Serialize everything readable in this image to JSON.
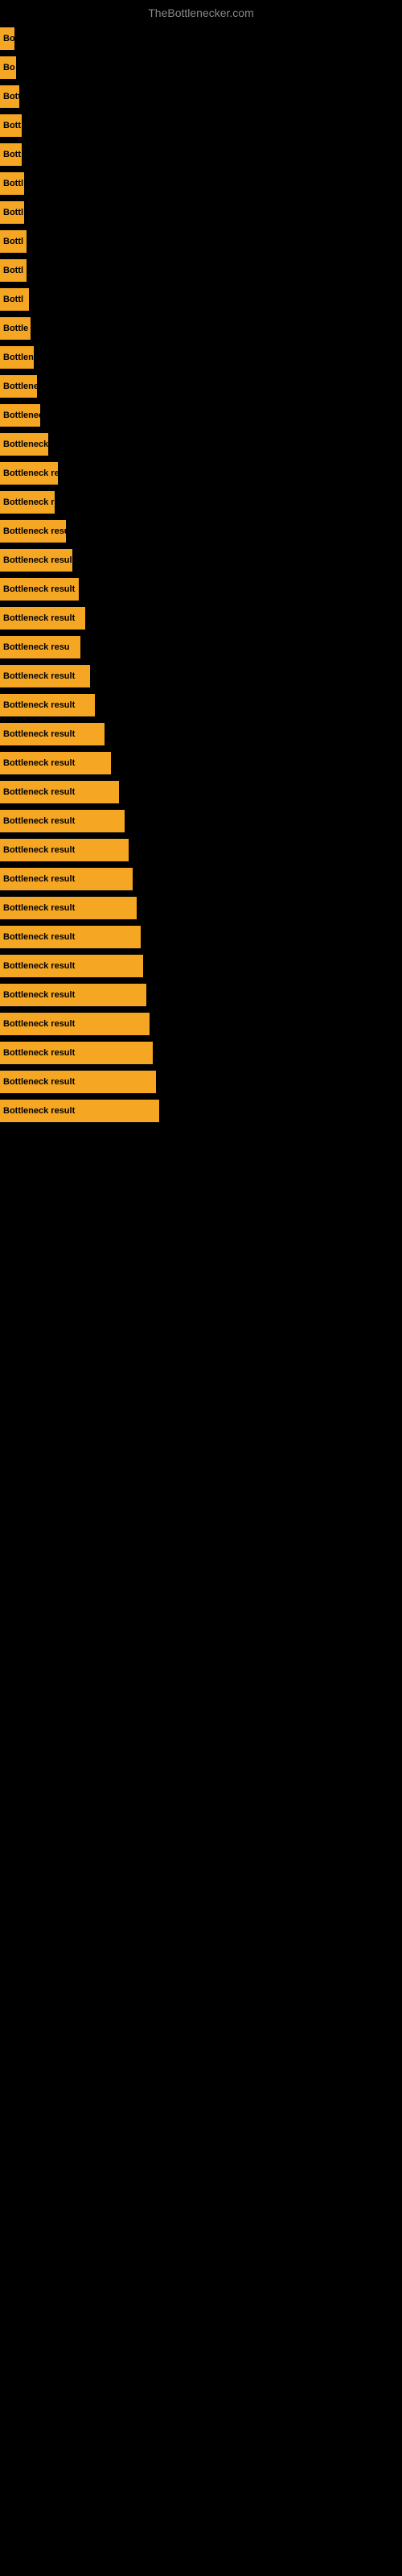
{
  "site_title": "TheBottlenecker.com",
  "bars": [
    {
      "label": "Bo",
      "width": 18
    },
    {
      "label": "Bo",
      "width": 20
    },
    {
      "label": "Bott",
      "width": 24
    },
    {
      "label": "Bott",
      "width": 27
    },
    {
      "label": "Bott",
      "width": 27
    },
    {
      "label": "Bottl",
      "width": 30
    },
    {
      "label": "Bottl",
      "width": 30
    },
    {
      "label": "Bottl",
      "width": 33
    },
    {
      "label": "Bottl",
      "width": 33
    },
    {
      "label": "Bottl",
      "width": 36
    },
    {
      "label": "Bottle",
      "width": 38
    },
    {
      "label": "Bottlen",
      "width": 42
    },
    {
      "label": "Bottlene",
      "width": 46
    },
    {
      "label": "Bottlenec",
      "width": 50
    },
    {
      "label": "Bottleneck r",
      "width": 60
    },
    {
      "label": "Bottleneck resu",
      "width": 72
    },
    {
      "label": "Bottleneck res",
      "width": 68
    },
    {
      "label": "Bottleneck result",
      "width": 82
    },
    {
      "label": "Bottleneck result",
      "width": 90
    },
    {
      "label": "Bottleneck result",
      "width": 98
    },
    {
      "label": "Bottleneck result",
      "width": 106
    },
    {
      "label": "Bottleneck resu",
      "width": 100
    },
    {
      "label": "Bottleneck result",
      "width": 112
    },
    {
      "label": "Bottleneck result",
      "width": 118
    },
    {
      "label": "Bottleneck result",
      "width": 130
    },
    {
      "label": "Bottleneck result",
      "width": 138
    },
    {
      "label": "Bottleneck result",
      "width": 148
    },
    {
      "label": "Bottleneck result",
      "width": 155
    },
    {
      "label": "Bottleneck result",
      "width": 160
    },
    {
      "label": "Bottleneck result",
      "width": 165
    },
    {
      "label": "Bottleneck result",
      "width": 170
    },
    {
      "label": "Bottleneck result",
      "width": 175
    },
    {
      "label": "Bottleneck result",
      "width": 178
    },
    {
      "label": "Bottleneck result",
      "width": 182
    },
    {
      "label": "Bottleneck result",
      "width": 186
    },
    {
      "label": "Bottleneck result",
      "width": 190
    },
    {
      "label": "Bottleneck result",
      "width": 194
    },
    {
      "label": "Bottleneck result",
      "width": 198
    }
  ]
}
